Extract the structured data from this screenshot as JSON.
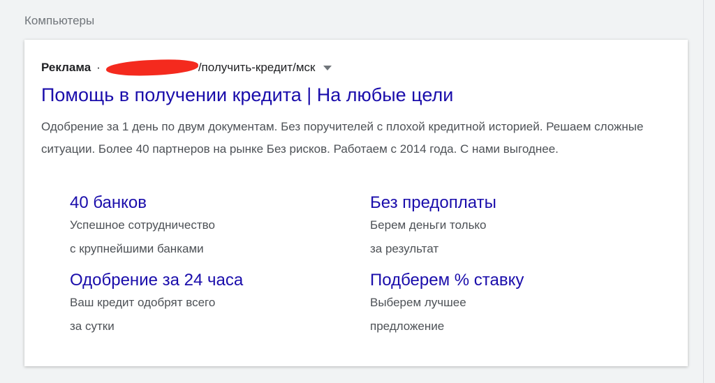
{
  "category": "Компьютеры",
  "ad": {
    "label": "Реклама",
    "separator": "·",
    "url_path": "/получить-кредит/мск",
    "title": "Помощь в получении кредита | На любые цели",
    "description": "Одобрение за 1 день по двум документам. Без поручителей с плохой кредитной историей. Решаем сложные ситуации. Более 40 партнеров на рынке Без рисков. Работаем с 2014 года. С нами выгоднее.",
    "sitelinks": [
      {
        "title": "40 банков",
        "line1": "Успешное сотрудничество",
        "line2": "с крупнейшими банками"
      },
      {
        "title": "Без предоплаты",
        "line1": "Берем деньги только",
        "line2": "за результат"
      },
      {
        "title": "Одобрение за 24 часа",
        "line1": "Ваш кредит одобрят всего",
        "line2": "за сутки"
      },
      {
        "title": "Подберем % ставку",
        "line1": "Выберем лучшее",
        "line2": "предложение"
      }
    ]
  }
}
